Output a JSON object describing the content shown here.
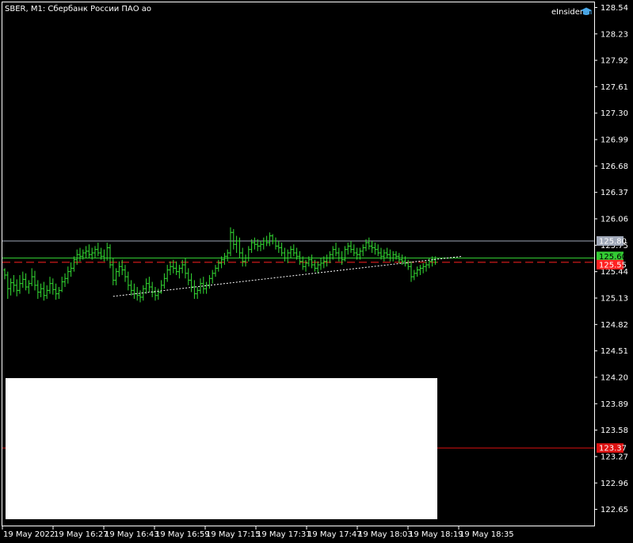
{
  "header": {
    "symbol_title": "SBER, M1:  Сбербанк России ПАО ао",
    "brand_label": "eInsider"
  },
  "colors": {
    "background": "#000000",
    "frame": "#ffffff",
    "bar": "#33dd33",
    "bid_line": "#33cc33",
    "ask_line": "#ff2222",
    "level_line": "#a0a8b8",
    "low_level_line": "#dd1111",
    "trend_line": "#ffffff",
    "panel": "#ffffff"
  },
  "chart_data": {
    "type": "ohlc",
    "symbol": "SBER",
    "timeframe": "M1",
    "y_ticks": [
      "128.54",
      "128.23",
      "127.92",
      "127.61",
      "127.30",
      "126.99",
      "126.68",
      "126.37",
      "126.06",
      "125.75",
      "125.44",
      "125.13",
      "124.82",
      "124.51",
      "124.20",
      "123.89",
      "123.58",
      "123.27",
      "122.96",
      "122.65"
    ],
    "ylim": [
      122.46,
      128.6
    ],
    "x_ticks": [
      "19 May 2022",
      "19 May 16:27",
      "19 May 16:43",
      "19 May 16:59",
      "19 May 17:15",
      "19 May 17:31",
      "19 May 17:47",
      "19 May 18:03",
      "19 May 18:19",
      "19 May 18:35"
    ],
    "price_tags": [
      {
        "value": "125.80",
        "kind": "level",
        "price": 125.8
      },
      {
        "value": "125.60",
        "kind": "bid",
        "price": 125.6
      },
      {
        "value": "125.55",
        "kind": "ask",
        "price": 125.55
      },
      {
        "value": "123.37",
        "kind": "low_level",
        "price": 123.37
      }
    ],
    "trend_line": {
      "from_bar": 36,
      "from_price": 125.15,
      "to_bar": 152,
      "to_price": 125.62
    },
    "bars": [
      [
        125.46,
        125.48,
        125.35,
        125.4
      ],
      [
        125.4,
        125.44,
        125.12,
        125.24
      ],
      [
        125.24,
        125.36,
        125.16,
        125.31
      ],
      [
        125.31,
        125.4,
        125.2,
        125.28
      ],
      [
        125.28,
        125.35,
        125.15,
        125.22
      ],
      [
        125.22,
        125.4,
        125.18,
        125.3
      ],
      [
        125.3,
        125.44,
        125.25,
        125.35
      ],
      [
        125.35,
        125.42,
        125.22,
        125.26
      ],
      [
        125.26,
        125.34,
        125.18,
        125.3
      ],
      [
        125.3,
        125.48,
        125.27,
        125.38
      ],
      [
        125.38,
        125.45,
        125.22,
        125.28
      ],
      [
        125.28,
        125.34,
        125.12,
        125.2
      ],
      [
        125.2,
        125.3,
        125.14,
        125.24
      ],
      [
        125.24,
        125.32,
        125.1,
        125.16
      ],
      [
        125.16,
        125.28,
        125.12,
        125.22
      ],
      [
        125.22,
        125.38,
        125.18,
        125.3
      ],
      [
        125.3,
        125.36,
        125.17,
        125.23
      ],
      [
        125.23,
        125.3,
        125.11,
        125.18
      ],
      [
        125.18,
        125.26,
        125.12,
        125.22
      ],
      [
        125.22,
        125.38,
        125.2,
        125.32
      ],
      [
        125.32,
        125.42,
        125.26,
        125.36
      ],
      [
        125.36,
        125.5,
        125.3,
        125.44
      ],
      [
        125.44,
        125.55,
        125.38,
        125.48
      ],
      [
        125.48,
        125.62,
        125.44,
        125.58
      ],
      [
        125.58,
        125.7,
        125.52,
        125.64
      ],
      [
        125.64,
        125.72,
        125.56,
        125.62
      ],
      [
        125.62,
        125.7,
        125.58,
        125.66
      ],
      [
        125.66,
        125.74,
        125.6,
        125.68
      ],
      [
        125.68,
        125.76,
        125.6,
        125.64
      ],
      [
        125.64,
        125.72,
        125.58,
        125.66
      ],
      [
        125.66,
        125.74,
        125.6,
        125.7
      ],
      [
        125.7,
        125.78,
        125.62,
        125.66
      ],
      [
        125.66,
        125.72,
        125.58,
        125.62
      ],
      [
        125.62,
        125.7,
        125.56,
        125.6
      ],
      [
        125.6,
        125.78,
        125.57,
        125.72
      ],
      [
        125.72,
        125.76,
        125.48,
        125.52
      ],
      [
        125.52,
        125.6,
        125.28,
        125.34
      ],
      [
        125.34,
        125.48,
        125.28,
        125.44
      ],
      [
        125.44,
        125.56,
        125.38,
        125.5
      ],
      [
        125.5,
        125.58,
        125.4,
        125.46
      ],
      [
        125.46,
        125.52,
        125.32,
        125.38
      ],
      [
        125.38,
        125.44,
        125.22,
        125.28
      ],
      [
        125.28,
        125.34,
        125.16,
        125.22
      ],
      [
        125.22,
        125.3,
        125.12,
        125.18
      ],
      [
        125.18,
        125.26,
        125.1,
        125.16
      ],
      [
        125.16,
        125.22,
        125.08,
        125.14
      ],
      [
        125.14,
        125.28,
        125.1,
        125.24
      ],
      [
        125.24,
        125.36,
        125.18,
        125.3
      ],
      [
        125.3,
        125.38,
        125.2,
        125.26
      ],
      [
        125.26,
        125.32,
        125.14,
        125.2
      ],
      [
        125.2,
        125.26,
        125.1,
        125.16
      ],
      [
        125.16,
        125.24,
        125.11,
        125.2
      ],
      [
        125.2,
        125.34,
        125.18,
        125.28
      ],
      [
        125.28,
        125.42,
        125.24,
        125.36
      ],
      [
        125.36,
        125.52,
        125.32,
        125.46
      ],
      [
        125.46,
        125.56,
        125.4,
        125.5
      ],
      [
        125.5,
        125.58,
        125.42,
        125.48
      ],
      [
        125.48,
        125.56,
        125.4,
        125.44
      ],
      [
        125.44,
        125.52,
        125.36,
        125.48
      ],
      [
        125.48,
        125.58,
        125.42,
        125.52
      ],
      [
        125.52,
        125.6,
        125.36,
        125.42
      ],
      [
        125.42,
        125.48,
        125.28,
        125.34
      ],
      [
        125.34,
        125.42,
        125.2,
        125.26
      ],
      [
        125.26,
        125.34,
        125.12,
        125.18
      ],
      [
        125.18,
        125.26,
        125.12,
        125.22
      ],
      [
        125.22,
        125.36,
        125.18,
        125.3
      ],
      [
        125.3,
        125.38,
        125.18,
        125.24
      ],
      [
        125.24,
        125.32,
        125.18,
        125.28
      ],
      [
        125.28,
        125.4,
        125.24,
        125.36
      ],
      [
        125.36,
        125.46,
        125.3,
        125.42
      ],
      [
        125.42,
        125.52,
        125.38,
        125.48
      ],
      [
        125.48,
        125.58,
        125.44,
        125.54
      ],
      [
        125.54,
        125.62,
        125.48,
        125.58
      ],
      [
        125.58,
        125.66,
        125.52,
        125.62
      ],
      [
        125.62,
        125.7,
        125.56,
        125.66
      ],
      [
        125.66,
        125.96,
        125.62,
        125.9
      ],
      [
        125.9,
        125.94,
        125.7,
        125.76
      ],
      [
        125.76,
        125.86,
        125.66,
        125.8
      ],
      [
        125.8,
        125.84,
        125.6,
        125.66
      ],
      [
        125.66,
        125.72,
        125.5,
        125.56
      ],
      [
        125.56,
        125.64,
        125.5,
        125.6
      ],
      [
        125.6,
        125.74,
        125.56,
        125.7
      ],
      [
        125.7,
        125.82,
        125.66,
        125.78
      ],
      [
        125.78,
        125.84,
        125.7,
        125.76
      ],
      [
        125.76,
        125.82,
        125.68,
        125.74
      ],
      [
        125.74,
        125.8,
        125.68,
        125.76
      ],
      [
        125.76,
        125.84,
        125.7,
        125.8
      ],
      [
        125.8,
        125.86,
        125.74,
        125.78
      ],
      [
        125.78,
        125.9,
        125.74,
        125.86
      ],
      [
        125.86,
        125.88,
        125.76,
        125.8
      ],
      [
        125.8,
        125.84,
        125.7,
        125.74
      ],
      [
        125.74,
        125.8,
        125.66,
        125.72
      ],
      [
        125.72,
        125.78,
        125.62,
        125.66
      ],
      [
        125.66,
        125.72,
        125.56,
        125.6
      ],
      [
        125.6,
        125.7,
        125.54,
        125.66
      ],
      [
        125.66,
        125.74,
        125.6,
        125.7
      ],
      [
        125.7,
        125.76,
        125.62,
        125.66
      ],
      [
        125.66,
        125.72,
        125.58,
        125.62
      ],
      [
        125.62,
        125.68,
        125.52,
        125.56
      ],
      [
        125.56,
        125.62,
        125.46,
        125.5
      ],
      [
        125.5,
        125.58,
        125.44,
        125.54
      ],
      [
        125.54,
        125.62,
        125.5,
        125.58
      ],
      [
        125.58,
        125.64,
        125.48,
        125.52
      ],
      [
        125.52,
        125.58,
        125.44,
        125.48
      ],
      [
        125.48,
        125.56,
        125.42,
        125.52
      ],
      [
        125.52,
        125.6,
        125.46,
        125.54
      ],
      [
        125.54,
        125.62,
        125.48,
        125.56
      ],
      [
        125.56,
        125.64,
        125.5,
        125.6
      ],
      [
        125.6,
        125.68,
        125.54,
        125.64
      ],
      [
        125.64,
        125.74,
        125.58,
        125.7
      ],
      [
        125.7,
        125.78,
        125.62,
        125.66
      ],
      [
        125.66,
        125.72,
        125.56,
        125.6
      ],
      [
        125.6,
        125.68,
        125.52,
        125.58
      ],
      [
        125.58,
        125.74,
        125.56,
        125.7
      ],
      [
        125.7,
        125.78,
        125.64,
        125.74
      ],
      [
        125.74,
        125.8,
        125.66,
        125.7
      ],
      [
        125.7,
        125.76,
        125.62,
        125.66
      ],
      [
        125.66,
        125.72,
        125.58,
        125.64
      ],
      [
        125.64,
        125.72,
        125.58,
        125.68
      ],
      [
        125.68,
        125.76,
        125.62,
        125.72
      ],
      [
        125.72,
        125.82,
        125.68,
        125.78
      ],
      [
        125.78,
        125.84,
        125.7,
        125.74
      ],
      [
        125.74,
        125.8,
        125.66,
        125.72
      ],
      [
        125.72,
        125.78,
        125.64,
        125.7
      ],
      [
        125.7,
        125.76,
        125.62,
        125.66
      ],
      [
        125.66,
        125.72,
        125.58,
        125.62
      ],
      [
        125.62,
        125.7,
        125.56,
        125.66
      ],
      [
        125.66,
        125.72,
        125.6,
        125.64
      ],
      [
        125.64,
        125.7,
        125.56,
        125.6
      ],
      [
        125.6,
        125.68,
        125.56,
        125.64
      ],
      [
        125.64,
        125.68,
        125.58,
        125.62
      ],
      [
        125.62,
        125.66,
        125.54,
        125.58
      ],
      [
        125.58,
        125.64,
        125.52,
        125.56
      ],
      [
        125.56,
        125.62,
        125.5,
        125.54
      ],
      [
        125.54,
        125.58,
        125.46,
        125.5
      ],
      [
        125.5,
        125.56,
        125.32,
        125.38
      ],
      [
        125.38,
        125.46,
        125.34,
        125.42
      ],
      [
        125.42,
        125.5,
        125.38,
        125.46
      ],
      [
        125.46,
        125.52,
        125.4,
        125.48
      ],
      [
        125.48,
        125.54,
        125.42,
        125.5
      ],
      [
        125.5,
        125.56,
        125.44,
        125.52
      ],
      [
        125.52,
        125.6,
        125.48,
        125.56
      ],
      [
        125.56,
        125.62,
        125.5,
        125.58
      ],
      [
        125.58,
        125.62,
        125.52,
        125.55
      ]
    ]
  }
}
